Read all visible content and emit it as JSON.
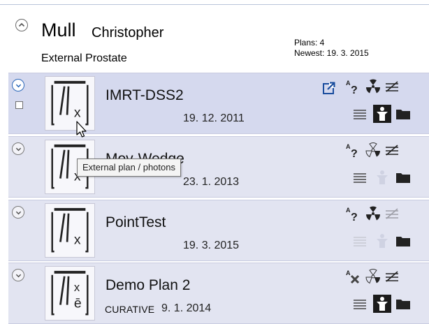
{
  "patient": {
    "surname": "Mull",
    "given_name": "Christopher",
    "diagnosis": "External Prostate",
    "plans_count": "Plans: 4",
    "newest": "Newest: 19. 3. 2015"
  },
  "tooltip": "External plan / photons",
  "plans": [
    {
      "name": "IMRT-DSS2",
      "date": "19. 12. 2011",
      "intent": "",
      "selected": true
    },
    {
      "name": "Mov-Wedge",
      "date": "23. 1. 2013",
      "intent": "",
      "selected": false
    },
    {
      "name": "PointTest",
      "date": "19. 3. 2015",
      "intent": "",
      "selected": false
    },
    {
      "name": "Demo Plan 2",
      "date": "9. 1. 2014",
      "intent": "CURATIVE",
      "selected": false
    }
  ],
  "icons": {
    "collapse": "chevron-up-icon",
    "expand": "chevron-down-icon",
    "external_link": "external-link-icon",
    "font_query": "font-query-icon",
    "radiation": "radiation-icon",
    "dose_profile": "dose-profile-icon",
    "notes": "notes-icon",
    "patient_model": "patient-model-icon",
    "folder": "folder-icon",
    "cursor": "mouse-pointer-icon"
  },
  "colors": {
    "row_background": "#e2e4f1",
    "selected_row_background": "#d5d9ee",
    "accent_blue": "#2a67b8"
  }
}
